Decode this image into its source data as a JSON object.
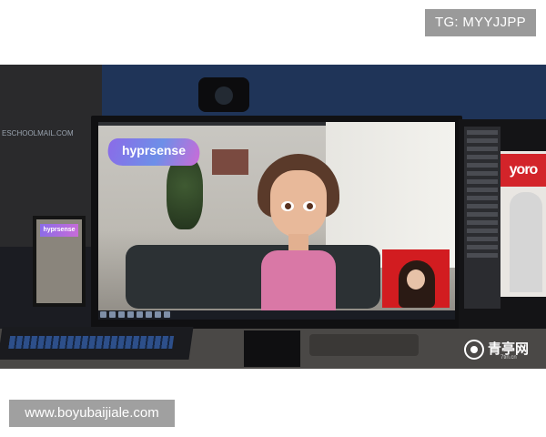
{
  "overlays": {
    "top_tag": "TG: MYYJJPP",
    "bottom_tag": "www.boyubaijiale.com"
  },
  "scene": {
    "logo_text": "hyprsense",
    "small_logo_text": "hyprsense",
    "right_banner_text": "yoro",
    "watermark_text": "青亭网",
    "watermark_sub": "7tin.cn",
    "shelf_caption": "ESCHOOLMAIL.COM"
  }
}
